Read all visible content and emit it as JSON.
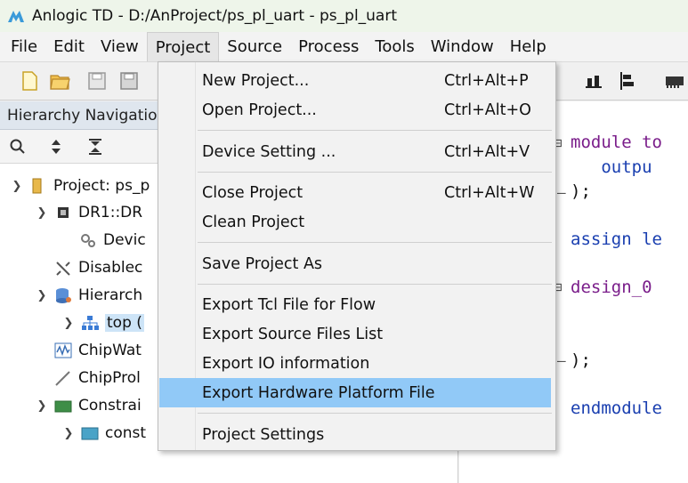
{
  "window": {
    "title": "Anlogic TD - D:/AnProject/ps_pl_uart - ps_pl_uart"
  },
  "menubar": [
    "File",
    "Edit",
    "View",
    "Project",
    "Source",
    "Process",
    "Tools",
    "Window",
    "Help"
  ],
  "panel": {
    "title": "Hierarchy Navigation"
  },
  "tree": [
    {
      "label": "Project: ps_p"
    },
    {
      "label": "DR1::DR"
    },
    {
      "label": "Devic"
    },
    {
      "label": "Disablec"
    },
    {
      "label": "Hierarch"
    },
    {
      "label": "top ("
    },
    {
      "label": "ChipWat"
    },
    {
      "label": "ChipProl"
    },
    {
      "label": "Constrai"
    },
    {
      "label": "const"
    }
  ],
  "editor": {
    "lines": [
      {
        "text": "module to"
      },
      {
        "text": "   outpu"
      },
      {
        "text": ");"
      },
      {
        "text": "assign le"
      },
      {
        "text": "design_0 "
      },
      {
        "text": ");"
      },
      {
        "text": "endmodule"
      }
    ]
  },
  "project_menu": {
    "items": [
      {
        "label": "New Project...",
        "shortcut": "Ctrl+Alt+P"
      },
      {
        "label": "Open Project...",
        "shortcut": "Ctrl+Alt+O"
      },
      {
        "label": "Device Setting ...",
        "shortcut": "Ctrl+Alt+V"
      },
      {
        "label": "Close Project",
        "shortcut": "Ctrl+Alt+W"
      },
      {
        "label": "Clean Project",
        "shortcut": ""
      },
      {
        "label": "Save Project As",
        "shortcut": ""
      },
      {
        "label": "Export Tcl File for Flow",
        "shortcut": ""
      },
      {
        "label": "Export Source Files List",
        "shortcut": ""
      },
      {
        "label": "Export IO information",
        "shortcut": ""
      },
      {
        "label": "Export Hardware Platform File",
        "shortcut": ""
      },
      {
        "label": "Project Settings",
        "shortcut": ""
      }
    ],
    "highlighted": "Export Hardware Platform File"
  },
  "colors": {
    "highlight": "#91c9f7",
    "keyword": "#7a1d8a",
    "keyword2": "#1a3fb0",
    "selection": "#cde4f7"
  }
}
